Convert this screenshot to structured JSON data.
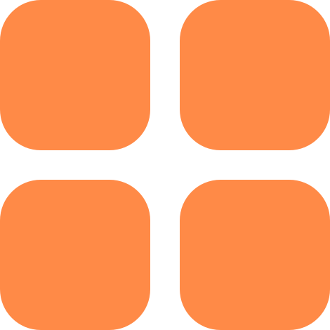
{
  "icon": {
    "name": "grid-view-icon",
    "tile_color": "#FF8A47",
    "background_color": "#FFFFFF",
    "tiles": [
      {
        "id": "top-left"
      },
      {
        "id": "top-right"
      },
      {
        "id": "bottom-left"
      },
      {
        "id": "bottom-right"
      }
    ]
  }
}
